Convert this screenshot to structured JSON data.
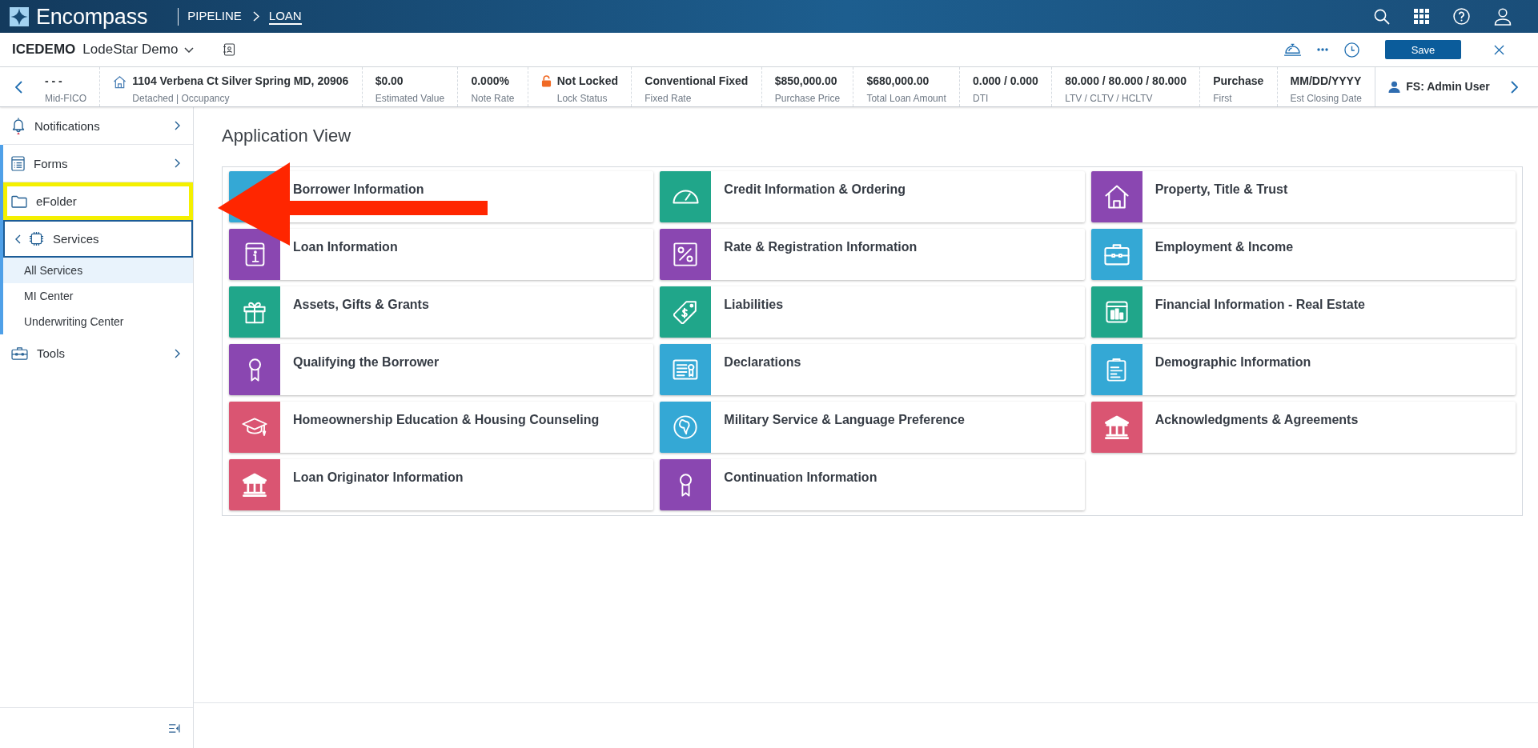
{
  "topbar": {
    "logo": "Encompass",
    "breadcrumbs": [
      {
        "label": "PIPELINE",
        "selected": false
      },
      {
        "label": "LOAN",
        "selected": true
      }
    ]
  },
  "loan_header": {
    "loan_id": "ICEDEMO",
    "loan_name": "LodeStar Demo",
    "save": "Save"
  },
  "summary": [
    {
      "kind": "plain",
      "value": "- - -",
      "label": "Mid-FICO"
    },
    {
      "kind": "address",
      "value": "1104 Verbena Ct Silver Spring MD, 20906",
      "label": "Detached | Occupancy"
    },
    {
      "kind": "plain",
      "value": "$0.00",
      "label": "Estimated Value"
    },
    {
      "kind": "plain",
      "value": "0.000%",
      "label": "Note Rate"
    },
    {
      "kind": "lock",
      "value": "Not Locked",
      "label": "Lock Status"
    },
    {
      "kind": "plain",
      "value": "Conventional Fixed",
      "label": "Fixed Rate"
    },
    {
      "kind": "plain",
      "value": "$850,000.00",
      "label": "Purchase Price"
    },
    {
      "kind": "plain",
      "value": "$680,000.00",
      "label": "Total Loan Amount"
    },
    {
      "kind": "plain",
      "value": "0.000 / 0.000",
      "label": "DTI"
    },
    {
      "kind": "plain",
      "value": "80.000 / 80.000 / 80.000",
      "label": "LTV / CLTV / HCLTV"
    },
    {
      "kind": "plain",
      "value": "Purchase",
      "label": "First"
    },
    {
      "kind": "plain",
      "value": "MM/DD/YYYY",
      "label": "Est Closing Date"
    },
    {
      "kind": "user",
      "value": "FS: Admin User"
    }
  ],
  "sidebar": {
    "items": [
      {
        "kind": "submenu",
        "label": "Notifications",
        "accent_bar": false,
        "highlighted": false
      },
      {
        "kind": "submenu",
        "label": "Forms",
        "accent_bar": true,
        "highlighted": false
      },
      {
        "kind": "page",
        "label": "eFolder",
        "accent_bar": true,
        "highlighted": true
      },
      {
        "kind": "group",
        "label": "Services",
        "accent_bar": true,
        "highlighted": false,
        "expanded": true,
        "children": [
          {
            "label": "All Services",
            "selected": true
          },
          {
            "label": "MI Center",
            "selected": false
          },
          {
            "label": "Underwriting Center",
            "selected": false
          }
        ]
      },
      {
        "kind": "submenu",
        "label": "Tools",
        "accent_bar": false,
        "highlighted": false
      }
    ]
  },
  "main": {
    "title": "Application View",
    "tiles": [
      {
        "label": "Borrower Information",
        "color": "#34a8d5"
      },
      {
        "label": "Credit Information & Ordering",
        "color": "#20a68a"
      },
      {
        "label": "Property, Title & Trust",
        "color": "#8a47b1"
      },
      {
        "label": "Loan Information",
        "color": "#8a47b1"
      },
      {
        "label": "Rate & Registration Information",
        "color": "#8a47b1"
      },
      {
        "label": "Employment & Income",
        "color": "#34a8d5"
      },
      {
        "label": "Assets, Gifts & Grants",
        "color": "#20a68a"
      },
      {
        "label": "Liabilities",
        "color": "#20a68a"
      },
      {
        "label": "Financial Information - Real Estate",
        "color": "#20a68a"
      },
      {
        "label": "Qualifying the Borrower",
        "color": "#8a47b1"
      },
      {
        "label": "Declarations",
        "color": "#34a8d5"
      },
      {
        "label": "Demographic Information",
        "color": "#34a8d5"
      },
      {
        "label": "Homeownership Education & Housing Counseling",
        "color": "#da5572"
      },
      {
        "label": "Military Service & Language Preference",
        "color": "#34a8d5"
      },
      {
        "label": "Acknowledgments & Agreements",
        "color": "#da5572"
      },
      {
        "label": "Loan Originator Information",
        "color": "#da5572"
      },
      {
        "label": "Continuation Information",
        "color": "#8a47b1"
      }
    ]
  }
}
